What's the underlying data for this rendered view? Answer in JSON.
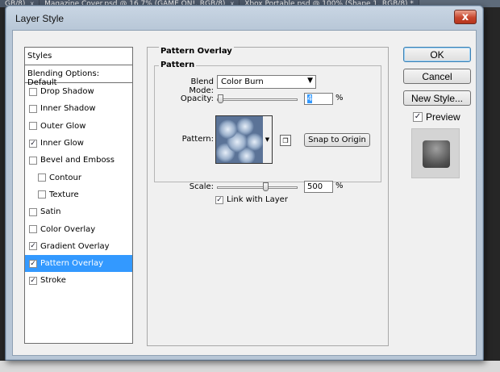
{
  "doc_tabs": [
    {
      "label": "GB/8)"
    },
    {
      "label": "Magazine Cover.psd @ 16.7% (GAME ON!, RGB/8)"
    },
    {
      "label": "Xbox Portable.psd @ 100% (Shape 1, RGB/8) *"
    }
  ],
  "window": {
    "title": "Layer Style",
    "close": "x"
  },
  "styles": {
    "header": "Styles",
    "blending_default": "Blending Options: Default",
    "items": [
      {
        "label": "Drop Shadow",
        "checked": false,
        "indent": false,
        "selected": false
      },
      {
        "label": "Inner Shadow",
        "checked": false,
        "indent": false,
        "selected": false
      },
      {
        "label": "Outer Glow",
        "checked": false,
        "indent": false,
        "selected": false
      },
      {
        "label": "Inner Glow",
        "checked": true,
        "indent": false,
        "selected": false
      },
      {
        "label": "Bevel and Emboss",
        "checked": false,
        "indent": false,
        "selected": false
      },
      {
        "label": "Contour",
        "checked": false,
        "indent": true,
        "selected": false
      },
      {
        "label": "Texture",
        "checked": false,
        "indent": true,
        "selected": false
      },
      {
        "label": "Satin",
        "checked": false,
        "indent": false,
        "selected": false
      },
      {
        "label": "Color Overlay",
        "checked": false,
        "indent": false,
        "selected": false
      },
      {
        "label": "Gradient Overlay",
        "checked": true,
        "indent": false,
        "selected": false
      },
      {
        "label": "Pattern Overlay",
        "checked": true,
        "indent": false,
        "selected": true
      },
      {
        "label": "Stroke",
        "checked": true,
        "indent": false,
        "selected": false
      }
    ]
  },
  "pattern_overlay": {
    "group_title": "Pattern Overlay",
    "sub_title": "Pattern",
    "blend_mode_label": "Blend Mode:",
    "blend_mode_value": "Color Burn",
    "opacity_label": "Opacity:",
    "opacity_value": "4",
    "opacity_fraction": 0.04,
    "percent": "%",
    "pattern_label": "Pattern:",
    "snap_to_origin": "Snap to Origin",
    "scale_label": "Scale:",
    "scale_value": "500",
    "scale_fraction": 0.6,
    "link_with_layer": "Link with Layer",
    "link_checked": true
  },
  "buttons": {
    "ok": "OK",
    "cancel": "Cancel",
    "new_style": "New Style...",
    "preview": "Preview",
    "preview_checked": true
  },
  "icons": {
    "check": "✓",
    "dropdown": "▼",
    "small_dropdown": "▸",
    "new_preset": "❐"
  }
}
